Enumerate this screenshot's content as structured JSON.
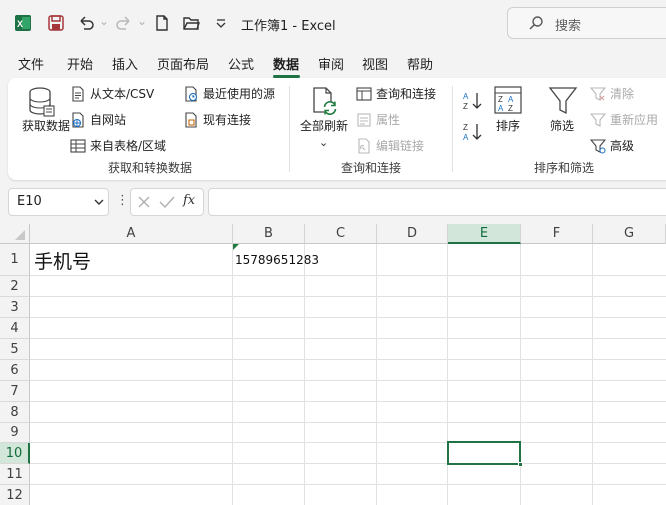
{
  "app": {
    "title": "工作簿1  -  Excel",
    "search_placeholder": "搜索",
    "accent_color": "#217346"
  },
  "quick_access": {
    "icons": [
      "excel-logo-icon",
      "save-icon",
      "undo-icon",
      "redo-icon",
      "new-file-icon",
      "open-folder-icon",
      "customize-qat-icon"
    ]
  },
  "menu": {
    "tabs": [
      "文件",
      "开始",
      "插入",
      "页面布局",
      "公式",
      "数据",
      "审阅",
      "视图",
      "帮助"
    ],
    "active": "数据"
  },
  "ribbon": {
    "get_data": {
      "big_button": "获取数据",
      "items": [
        "从文本/CSV",
        "自网站",
        "来自表格/区域",
        "最近使用的源",
        "现有连接"
      ],
      "group_label": "获取和转换数据"
    },
    "queries": {
      "big_button": "全部刷新",
      "items": [
        "查询和连接",
        "属性",
        "编辑链接"
      ],
      "group_label": "查询和连接"
    },
    "sort_filter": {
      "sort_label": "排序",
      "filter_label": "筛选",
      "items": [
        "清除",
        "重新应用",
        "高级"
      ],
      "group_label": "排序和筛选"
    }
  },
  "formula_bar": {
    "name_box": "E10",
    "fx_label": "fx",
    "formula": ""
  },
  "sheet": {
    "columns": [
      "A",
      "B",
      "C",
      "D",
      "E",
      "F",
      "G"
    ],
    "rows": [
      "1",
      "2",
      "3",
      "4",
      "5",
      "6",
      "7",
      "8",
      "9",
      "10",
      "11",
      "12"
    ],
    "selected_cell": "E10",
    "cells": {
      "A1": "手机号",
      "B1": "15789651283"
    }
  }
}
